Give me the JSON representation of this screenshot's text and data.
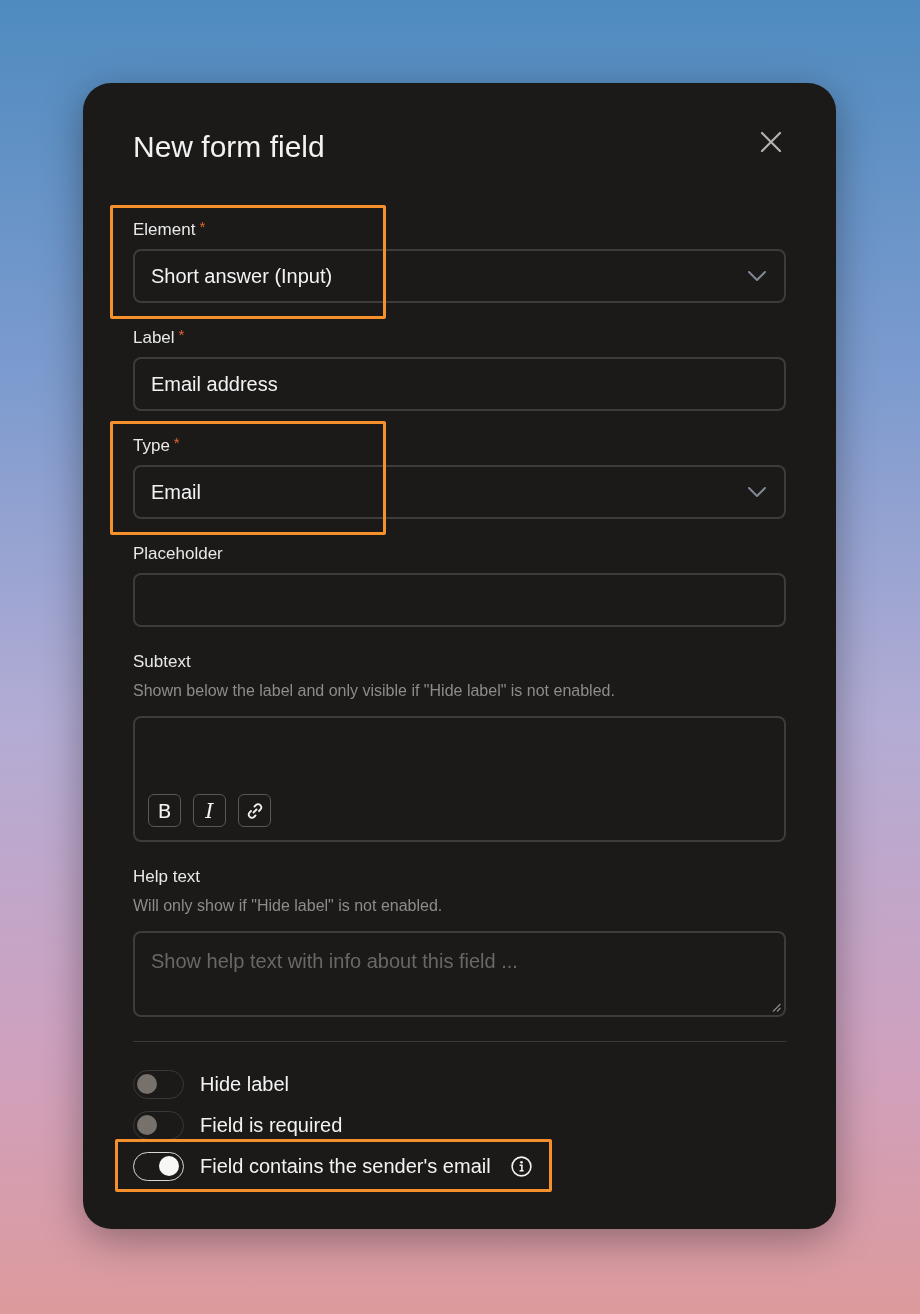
{
  "dialog": {
    "title": "New form field"
  },
  "fields": [
    {
      "kind": "select",
      "label": "Element",
      "required_mark": "*",
      "value": "Short answer (Input)",
      "highlighted": true
    },
    {
      "kind": "input",
      "label": "Label",
      "required_mark": "*",
      "value": "Email address",
      "highlighted": false
    },
    {
      "kind": "select",
      "label": "Type",
      "required_mark": "*",
      "value": "Email",
      "highlighted": true
    },
    {
      "kind": "input",
      "label": "Placeholder",
      "highlighted": false
    },
    {
      "kind": "rich_text",
      "label": "Subtext",
      "description": "Shown below the label and only visible if \"Hide label\" is not enabled.",
      "highlighted": false,
      "toolbar": [
        {
          "kind": "bold",
          "label": "B"
        },
        {
          "kind": "italic",
          "label": "I"
        },
        {
          "kind": "link"
        }
      ]
    },
    {
      "kind": "textarea",
      "label": "Help text",
      "description": "Will only show if \"Hide label\" is not enabled.",
      "placeholder": "Show help text with info about this field ...",
      "highlighted": false
    }
  ],
  "toggles": [
    {
      "label": "Hide label",
      "on": false,
      "highlighted": false,
      "info": false
    },
    {
      "label": "Field is required",
      "on": false,
      "highlighted": false,
      "info": false
    },
    {
      "label": "Field contains the sender's email",
      "on": true,
      "highlighted": true,
      "info": true
    }
  ]
}
